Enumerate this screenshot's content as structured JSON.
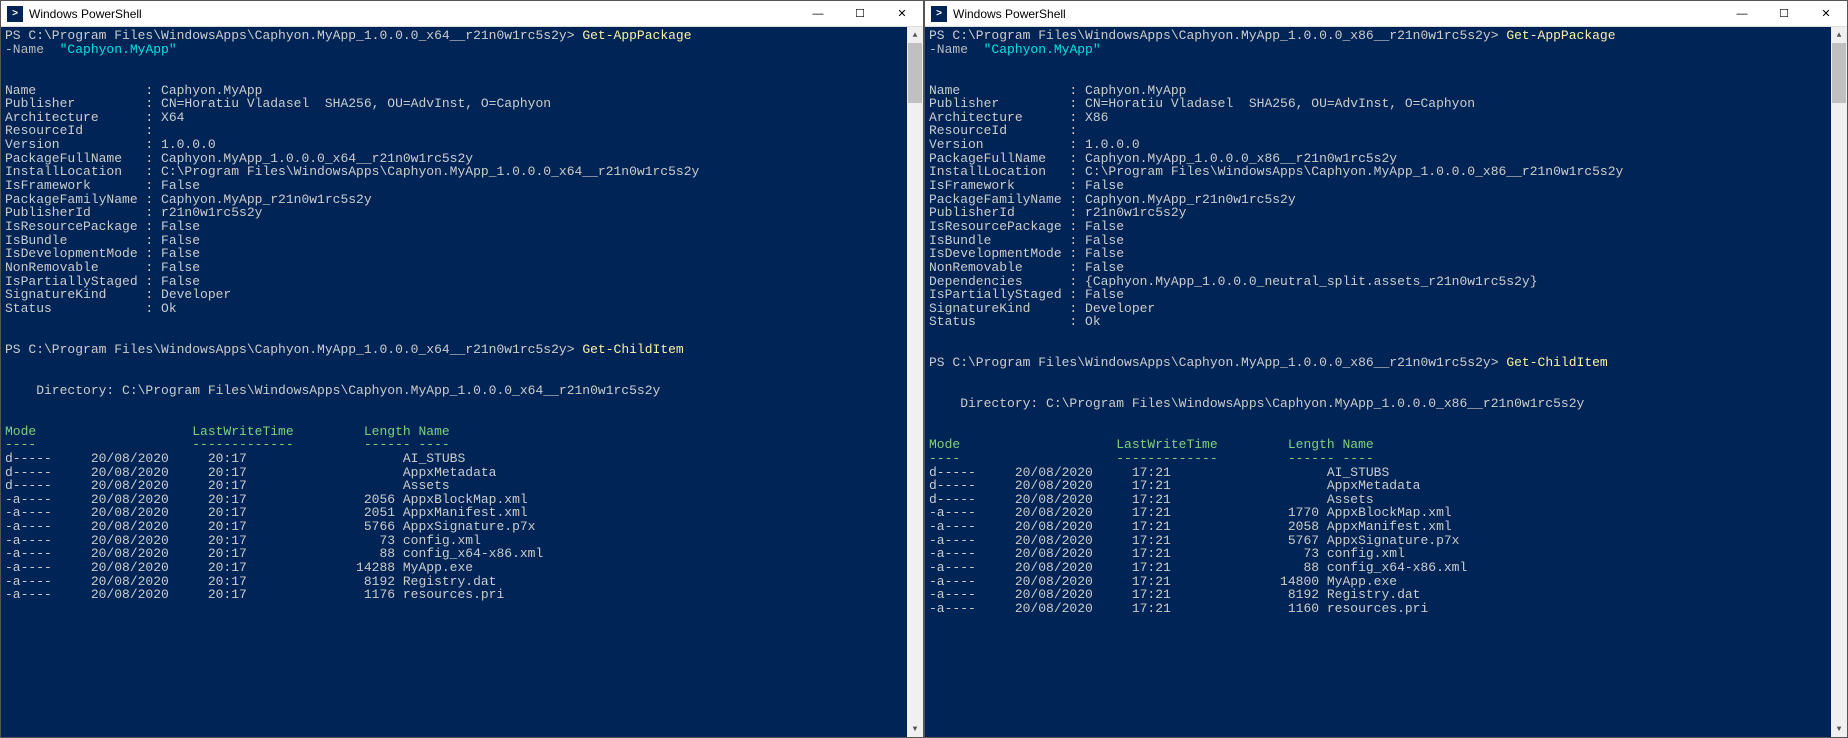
{
  "windows": [
    {
      "title": "Windows PowerShell",
      "prompt_path": "PS C:\\Program Files\\WindowsApps\\Caphyon.MyApp_1.0.0.0_x64__r21n0w1rc5s2y>",
      "cmd_getapp": "Get-AppPackage",
      "param_name": "-Name",
      "param_val": "\"Caphyon.MyApp\"",
      "pkg": {
        "Name": "Caphyon.MyApp",
        "Publisher": "CN=Horatiu Vladasel  SHA256, OU=AdvInst, O=Caphyon",
        "Architecture": "X64",
        "ResourceId": "",
        "Version": "1.0.0.0",
        "PackageFullName": "Caphyon.MyApp_1.0.0.0_x64__r21n0w1rc5s2y",
        "InstallLocation": "C:\\Program Files\\WindowsApps\\Caphyon.MyApp_1.0.0.0_x64__r21n0w1rc5s2y",
        "IsFramework": "False",
        "PackageFamilyName": "Caphyon.MyApp_r21n0w1rc5s2y",
        "PublisherId": "r21n0w1rc5s2y",
        "IsResourcePackage": "False",
        "IsBundle": "False",
        "IsDevelopmentMode": "False",
        "NonRemovable": "False",
        "IsPartiallyStaged": "False",
        "SignatureKind": "Developer",
        "Status": "Ok"
      },
      "cmd_childitem": "Get-ChildItem",
      "dir_label": "    Directory: C:\\Program Files\\WindowsApps\\Caphyon.MyApp_1.0.0.0_x64__r21n0w1rc5s2y",
      "hdr_mode": "Mode",
      "hdr_lwt": "LastWriteTime",
      "hdr_len": "Length",
      "hdr_name": "Name",
      "files": [
        {
          "mode": "d-----",
          "date": "20/08/2020",
          "time": "20:17",
          "len": "",
          "name": "AI_STUBS"
        },
        {
          "mode": "d-----",
          "date": "20/08/2020",
          "time": "20:17",
          "len": "",
          "name": "AppxMetadata"
        },
        {
          "mode": "d-----",
          "date": "20/08/2020",
          "time": "20:17",
          "len": "",
          "name": "Assets"
        },
        {
          "mode": "-a----",
          "date": "20/08/2020",
          "time": "20:17",
          "len": "2056",
          "name": "AppxBlockMap.xml"
        },
        {
          "mode": "-a----",
          "date": "20/08/2020",
          "time": "20:17",
          "len": "2051",
          "name": "AppxManifest.xml"
        },
        {
          "mode": "-a----",
          "date": "20/08/2020",
          "time": "20:17",
          "len": "5766",
          "name": "AppxSignature.p7x"
        },
        {
          "mode": "-a----",
          "date": "20/08/2020",
          "time": "20:17",
          "len": "73",
          "name": "config.xml"
        },
        {
          "mode": "-a----",
          "date": "20/08/2020",
          "time": "20:17",
          "len": "88",
          "name": "config_x64-x86.xml"
        },
        {
          "mode": "-a----",
          "date": "20/08/2020",
          "time": "20:17",
          "len": "14288",
          "name": "MyApp.exe"
        },
        {
          "mode": "-a----",
          "date": "20/08/2020",
          "time": "20:17",
          "len": "8192",
          "name": "Registry.dat"
        },
        {
          "mode": "-a----",
          "date": "20/08/2020",
          "time": "20:17",
          "len": "1176",
          "name": "resources.pri"
        }
      ]
    },
    {
      "title": "Windows PowerShell",
      "prompt_path": "PS C:\\Program Files\\WindowsApps\\Caphyon.MyApp_1.0.0.0_x86__r21n0w1rc5s2y>",
      "cmd_getapp": "Get-AppPackage",
      "param_name": "-Name",
      "param_val": "\"Caphyon.MyApp\"",
      "pkg": {
        "Name": "Caphyon.MyApp",
        "Publisher": "CN=Horatiu Vladasel  SHA256, OU=AdvInst, O=Caphyon",
        "Architecture": "X86",
        "ResourceId": "",
        "Version": "1.0.0.0",
        "PackageFullName": "Caphyon.MyApp_1.0.0.0_x86__r21n0w1rc5s2y",
        "InstallLocation": "C:\\Program Files\\WindowsApps\\Caphyon.MyApp_1.0.0.0_x86__r21n0w1rc5s2y",
        "IsFramework": "False",
        "PackageFamilyName": "Caphyon.MyApp_r21n0w1rc5s2y",
        "PublisherId": "r21n0w1rc5s2y",
        "IsResourcePackage": "False",
        "IsBundle": "False",
        "IsDevelopmentMode": "False",
        "NonRemovable": "False",
        "Dependencies": "{Caphyon.MyApp_1.0.0.0_neutral_split.assets_r21n0w1rc5s2y}",
        "IsPartiallyStaged": "False",
        "SignatureKind": "Developer",
        "Status": "Ok"
      },
      "cmd_childitem": "Get-ChildItem",
      "dir_label": "    Directory: C:\\Program Files\\WindowsApps\\Caphyon.MyApp_1.0.0.0_x86__r21n0w1rc5s2y",
      "hdr_mode": "Mode",
      "hdr_lwt": "LastWriteTime",
      "hdr_len": "Length",
      "hdr_name": "Name",
      "files": [
        {
          "mode": "d-----",
          "date": "20/08/2020",
          "time": "17:21",
          "len": "",
          "name": "AI_STUBS"
        },
        {
          "mode": "d-----",
          "date": "20/08/2020",
          "time": "17:21",
          "len": "",
          "name": "AppxMetadata"
        },
        {
          "mode": "d-----",
          "date": "20/08/2020",
          "time": "17:21",
          "len": "",
          "name": "Assets"
        },
        {
          "mode": "-a----",
          "date": "20/08/2020",
          "time": "17:21",
          "len": "1770",
          "name": "AppxBlockMap.xml"
        },
        {
          "mode": "-a----",
          "date": "20/08/2020",
          "time": "17:21",
          "len": "2058",
          "name": "AppxManifest.xml"
        },
        {
          "mode": "-a----",
          "date": "20/08/2020",
          "time": "17:21",
          "len": "5767",
          "name": "AppxSignature.p7x"
        },
        {
          "mode": "-a----",
          "date": "20/08/2020",
          "time": "17:21",
          "len": "73",
          "name": "config.xml"
        },
        {
          "mode": "-a----",
          "date": "20/08/2020",
          "time": "17:21",
          "len": "88",
          "name": "config_x64-x86.xml"
        },
        {
          "mode": "-a----",
          "date": "20/08/2020",
          "time": "17:21",
          "len": "14800",
          "name": "MyApp.exe"
        },
        {
          "mode": "-a----",
          "date": "20/08/2020",
          "time": "17:21",
          "len": "8192",
          "name": "Registry.dat"
        },
        {
          "mode": "-a----",
          "date": "20/08/2020",
          "time": "17:21",
          "len": "1160",
          "name": "resources.pri"
        }
      ]
    }
  ]
}
